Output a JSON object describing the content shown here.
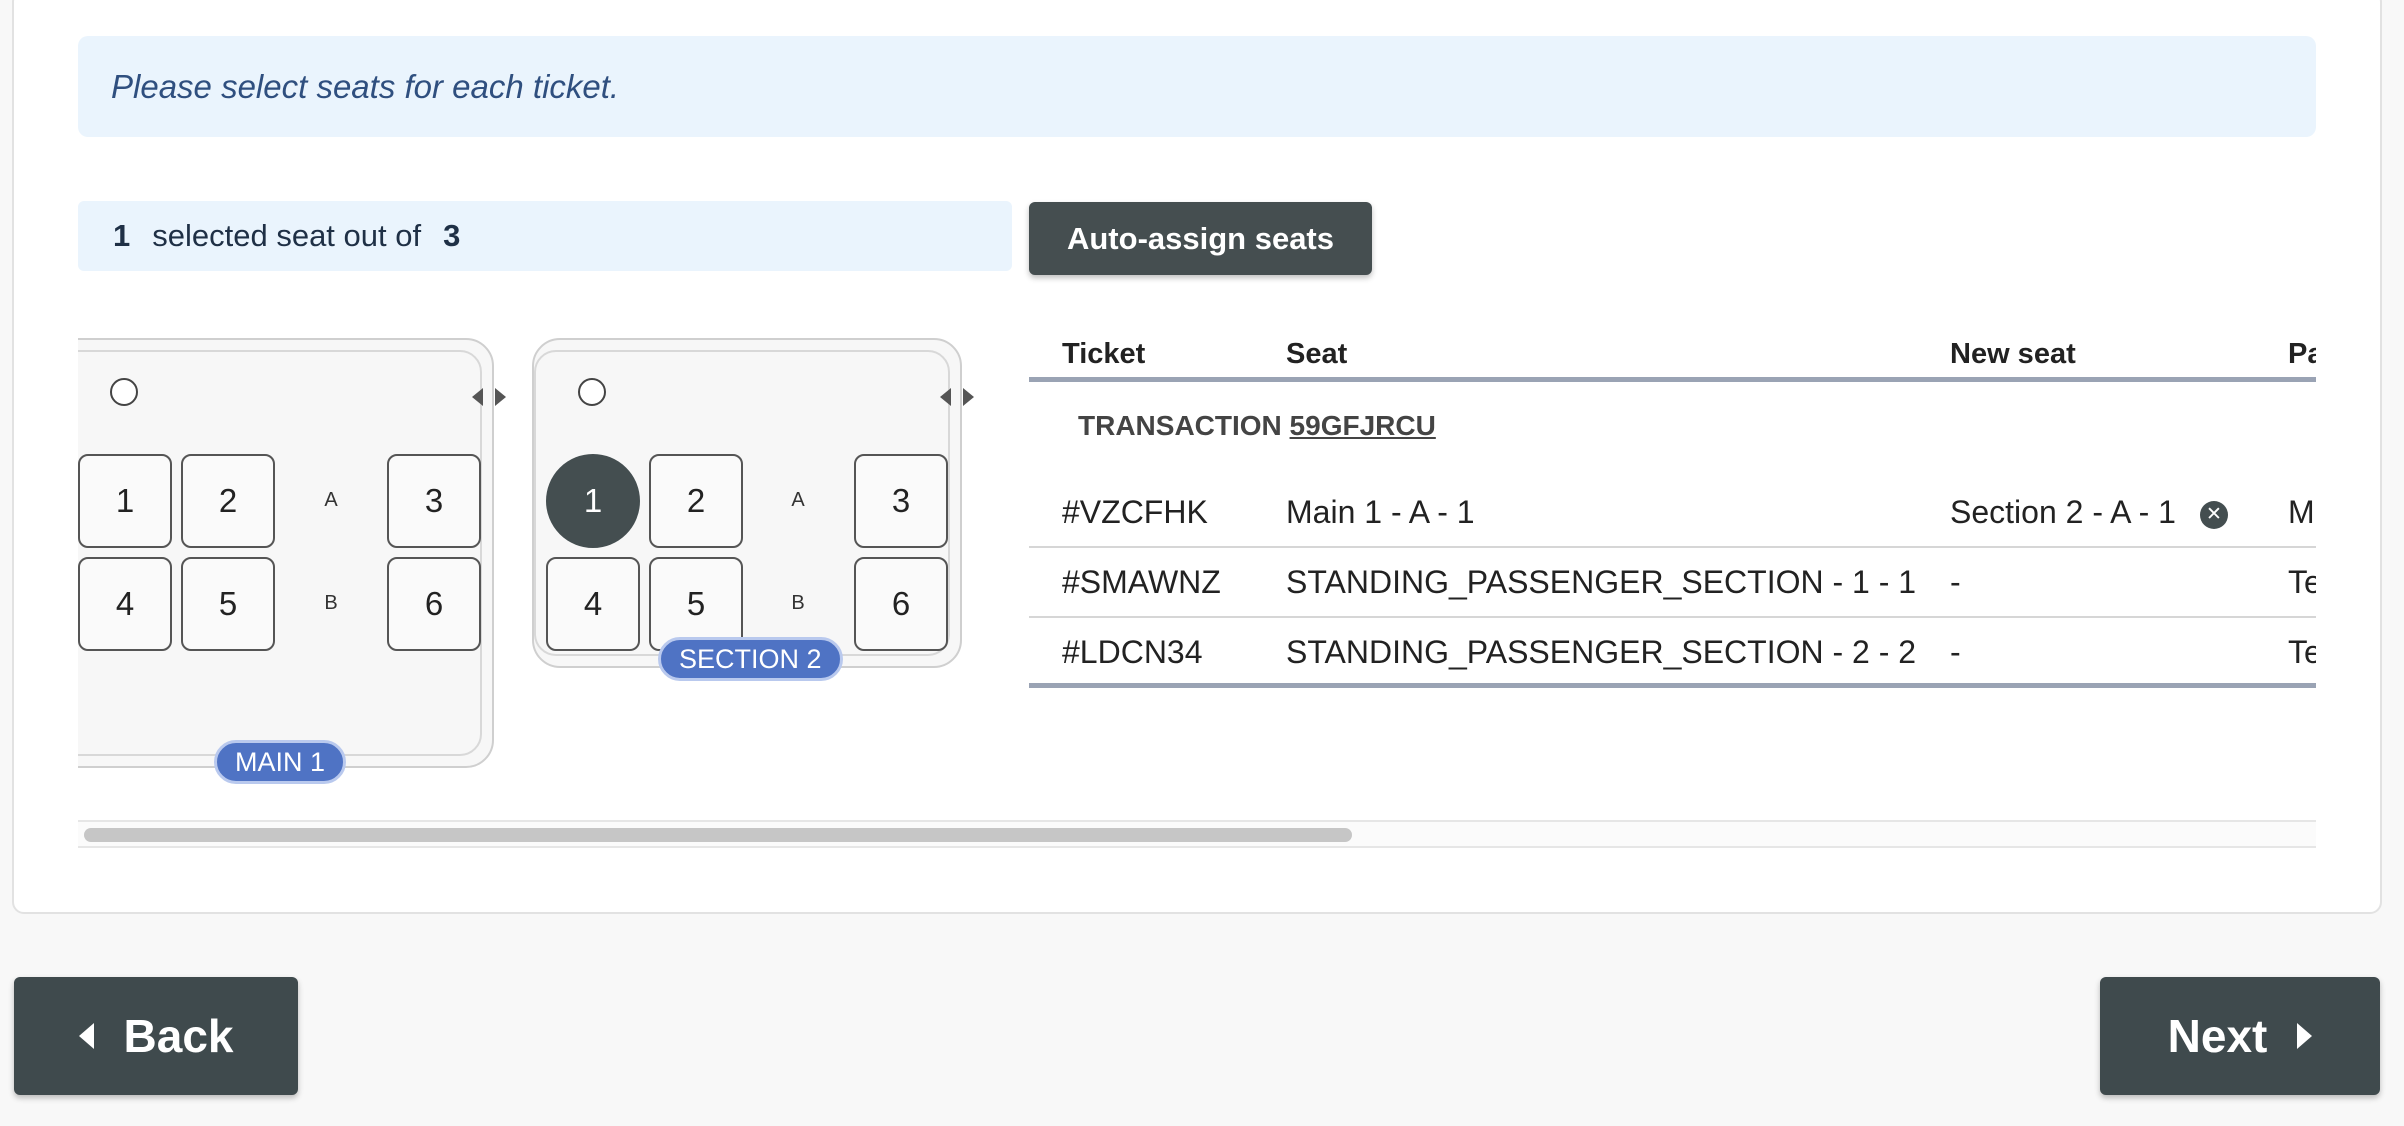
{
  "info_message": "Please select seats for each ticket.",
  "counter": {
    "selected": "1",
    "text": "selected seat out of",
    "total": "3"
  },
  "auto_assign_label": "Auto-assign seats",
  "sections": [
    {
      "name": "MAIN 1",
      "row_labels": [
        "A",
        "B"
      ],
      "seats": [
        "1",
        "2",
        "3",
        "4",
        "5",
        "6"
      ],
      "selected_seat": null
    },
    {
      "name": "SECTION 2",
      "row_labels": [
        "A",
        "B"
      ],
      "seats": [
        "1",
        "2",
        "3",
        "4",
        "5",
        "6"
      ],
      "selected_seat": "1"
    }
  ],
  "table": {
    "headers": [
      "Ticket",
      "Seat",
      "New seat",
      "Pa"
    ],
    "transaction_label": "TRANSACTION",
    "transaction_code": "59GFJRCU",
    "rows": [
      {
        "ticket": "#VZCFHK",
        "seat": "Main 1 - A - 1",
        "new_seat": "Section 2 - A - 1",
        "extra": "M",
        "clear_icon": "times-circle-icon"
      },
      {
        "ticket": "#SMAWNZ",
        "seat": "STANDING_PASSENGER_SECTION - 1 - 1",
        "new_seat": "-",
        "extra": "Te"
      },
      {
        "ticket": "#LDCN34",
        "seat": "STANDING_PASSENGER_SECTION - 2 - 2",
        "new_seat": "-",
        "extra": "Te"
      }
    ]
  },
  "nav": {
    "back_label": "Back",
    "next_label": "Next"
  },
  "colors": {
    "accent_dark": "#454e50",
    "info_bg": "#eaf4fd",
    "badge": "#4f73c4"
  }
}
